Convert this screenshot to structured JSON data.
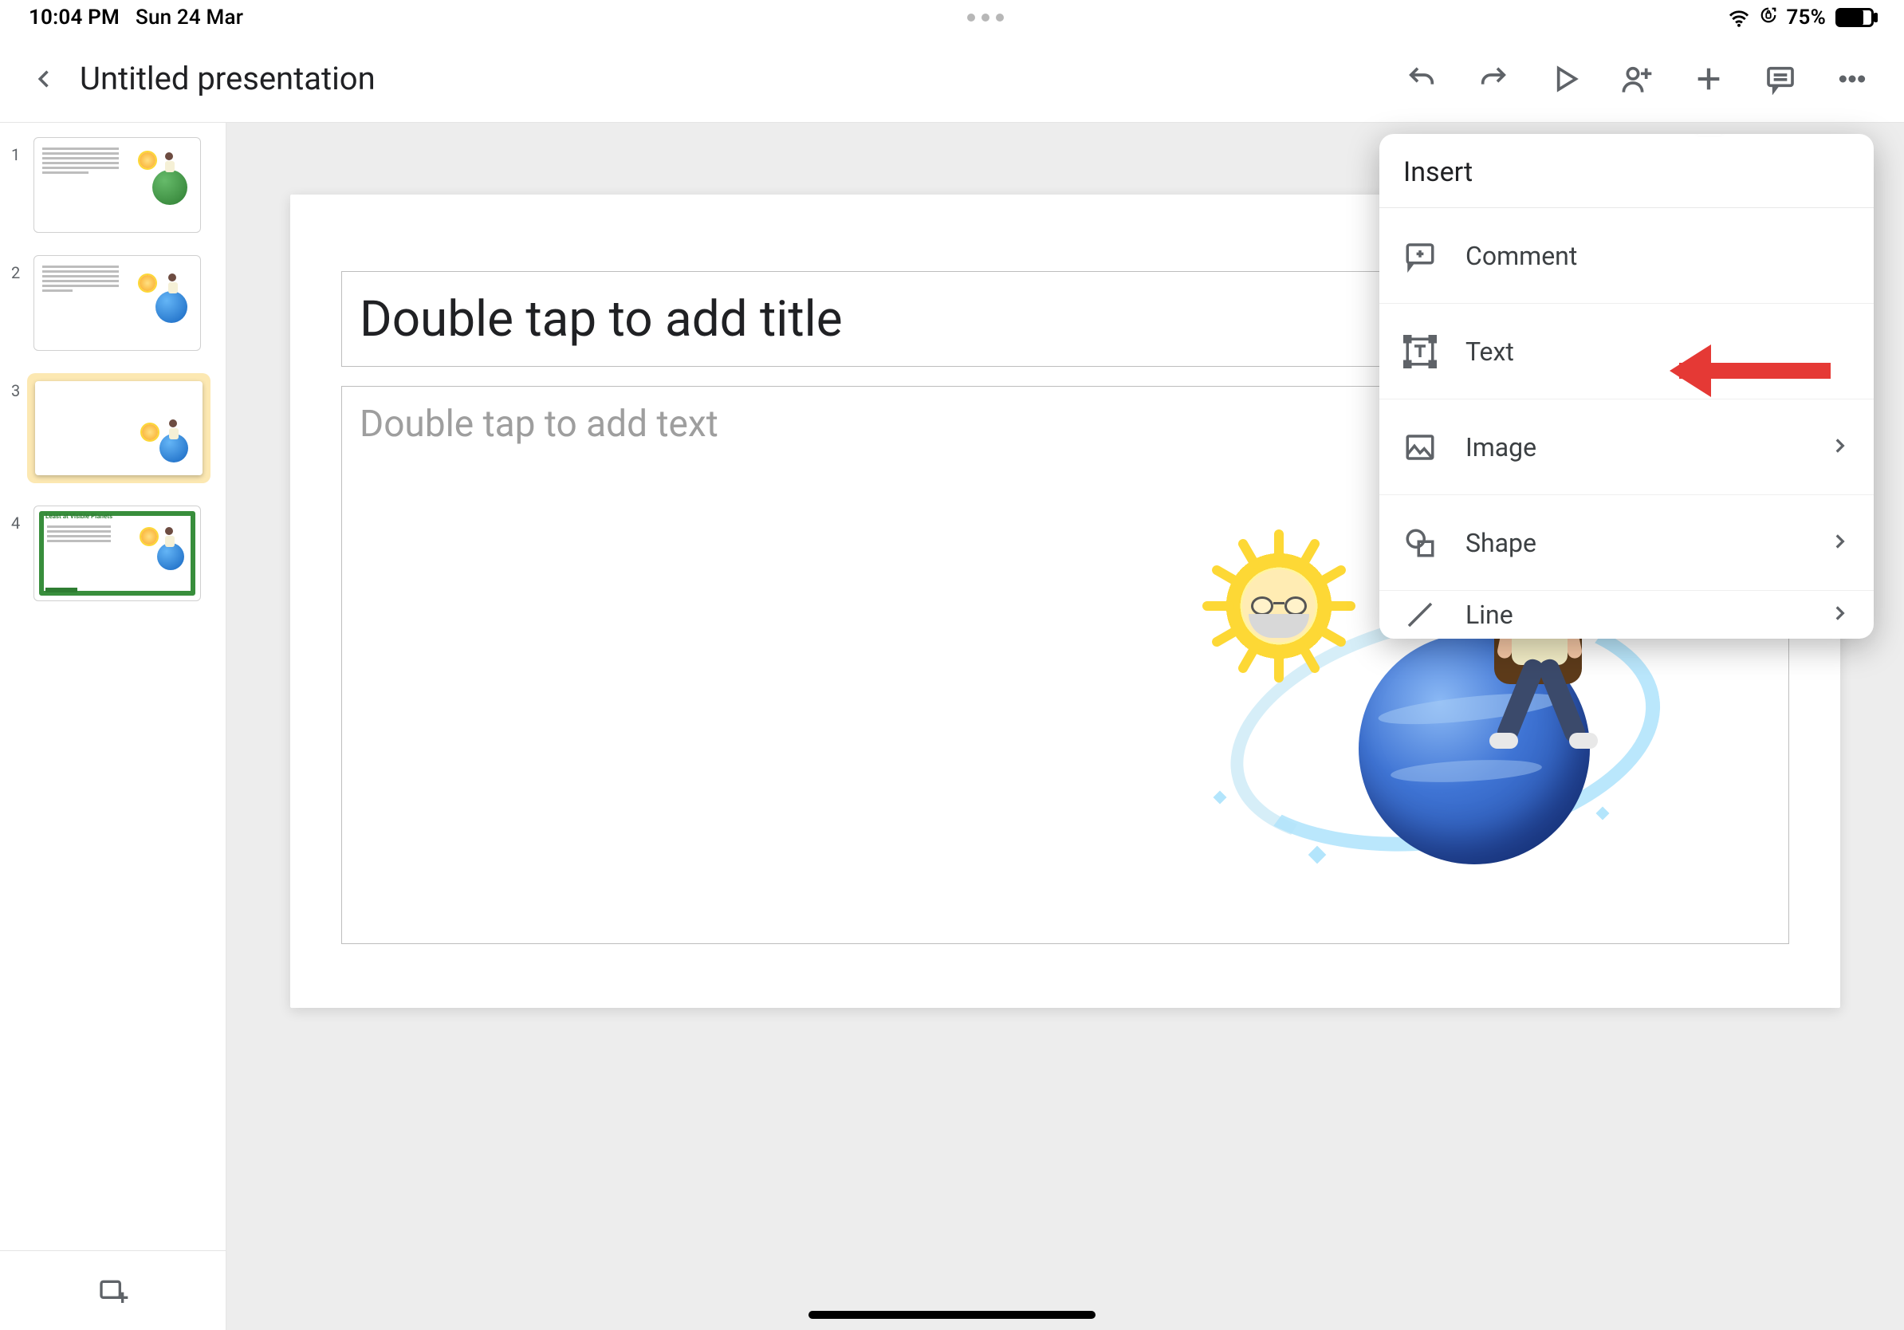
{
  "statusbar": {
    "time": "10:04 PM",
    "date": "Sun 24 Mar",
    "battery_pct": "75%"
  },
  "header": {
    "doc_title": "Untitled presentation"
  },
  "thumbnails": {
    "n1": "1",
    "n2": "2",
    "n3": "3",
    "n4": "4",
    "selected_index": 3
  },
  "slide": {
    "title_placeholder": "Double tap to add title",
    "body_placeholder": "Double tap to add text"
  },
  "popover": {
    "title": "Insert",
    "items": {
      "comment": "Comment",
      "text": "Text",
      "image": "Image",
      "shape": "Shape",
      "line": "Line"
    }
  }
}
